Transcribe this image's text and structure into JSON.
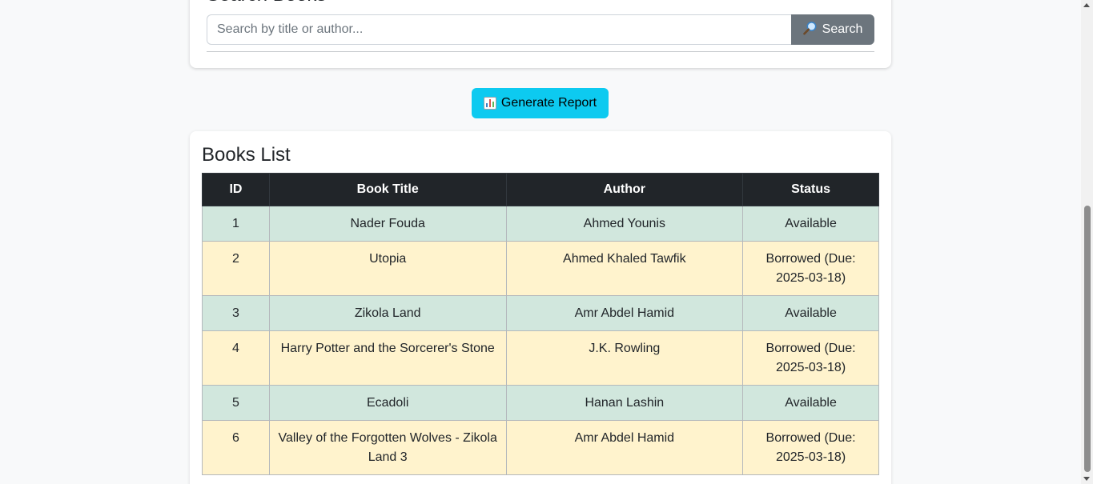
{
  "search": {
    "title": "Search Books",
    "placeholder": "Search by title or author...",
    "button_label": "Search",
    "button_icon": "magnifier-icon"
  },
  "report": {
    "button_label": "Generate Report",
    "button_icon": "bar-chart-icon"
  },
  "books": {
    "title": "Books List",
    "columns": [
      "ID",
      "Book Title",
      "Author",
      "Status"
    ],
    "rows": [
      {
        "id": "1",
        "title": "Nader Fouda",
        "author": "Ahmed Younis",
        "status": "Available",
        "state": "available"
      },
      {
        "id": "2",
        "title": "Utopia",
        "author": "Ahmed Khaled Tawfik",
        "status": "Borrowed (Due: 2025-03-18)",
        "state": "borrowed"
      },
      {
        "id": "3",
        "title": "Zikola Land",
        "author": "Amr Abdel Hamid",
        "status": "Available",
        "state": "available"
      },
      {
        "id": "4",
        "title": "Harry Potter and the Sorcerer's Stone",
        "author": "J.K. Rowling",
        "status": "Borrowed (Due: 2025-03-18)",
        "state": "borrowed"
      },
      {
        "id": "5",
        "title": "Ecadoli",
        "author": "Hanan Lashin",
        "status": "Available",
        "state": "available"
      },
      {
        "id": "6",
        "title": "Valley of the Forgotten Wolves - Zikola Land 3",
        "author": "Amr Abdel Hamid",
        "status": "Borrowed (Due: 2025-03-18)",
        "state": "borrowed"
      }
    ]
  },
  "colors": {
    "header_bg": "#212529",
    "available_row": "#d1e7dd",
    "borrowed_row": "#fff3cd",
    "report_button": "#0dcaf0",
    "search_button": "#6c757d"
  }
}
